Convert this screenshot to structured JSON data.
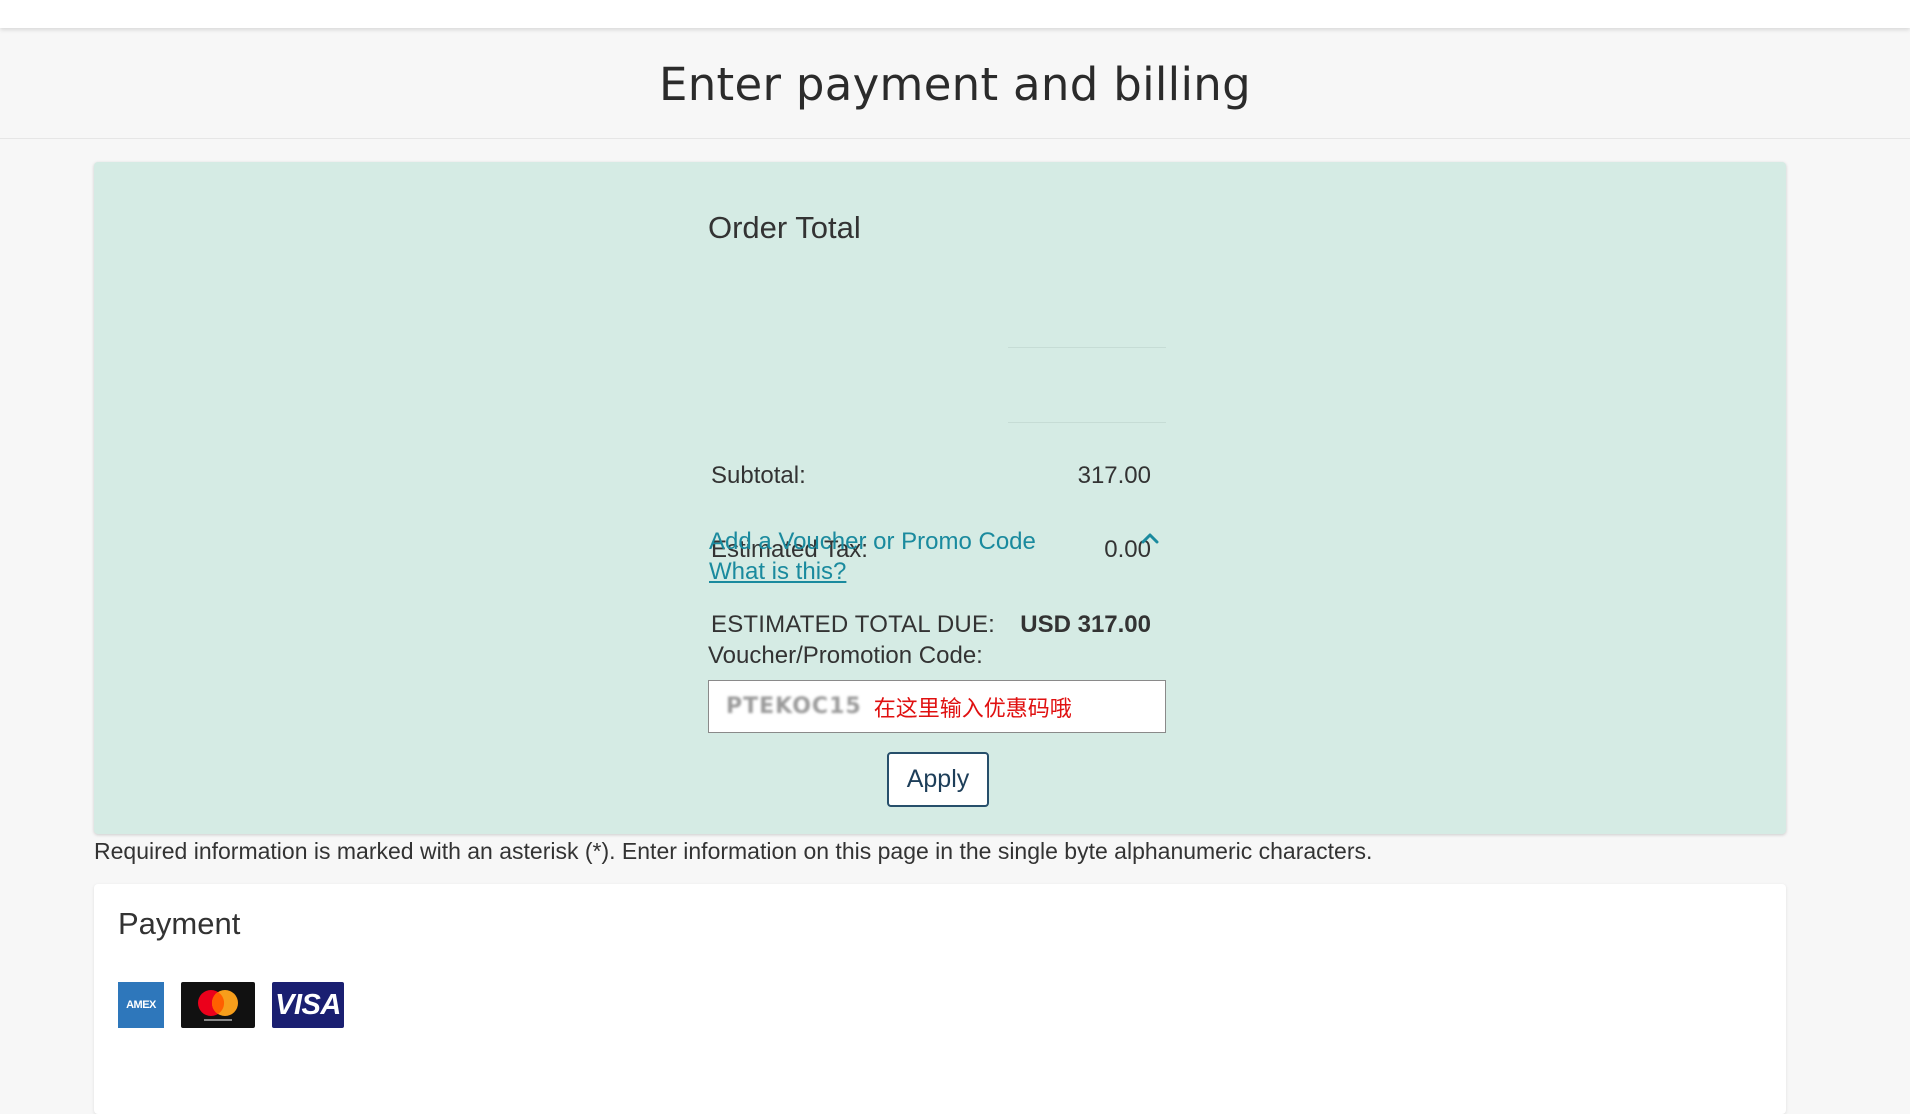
{
  "page": {
    "title": "Enter payment and billing"
  },
  "order": {
    "heading": "Order Total",
    "subtotal_label": "Subtotal:",
    "subtotal_value": "317.00",
    "tax_label": "Estimated Tax:",
    "tax_value": "0.00",
    "total_label": "ESTIMATED TOTAL DUE:",
    "total_value": "USD 317.00",
    "voucher_toggle": "Add a Voucher or Promo Code",
    "what_is_this": "What is this?",
    "voucher_label": "Voucher/Promotion Code:",
    "voucher_value": "PTEKOC15",
    "voucher_hint": "在这里输入优惠码哦",
    "apply_label": "Apply"
  },
  "notice": {
    "required_text": "Required information is marked with an asterisk (*). Enter information on this page in the single byte alphanumeric characters."
  },
  "payment": {
    "heading": "Payment",
    "cards": {
      "amex": "AMEX",
      "visa": "VISA"
    }
  },
  "colors": {
    "panel_background": "#d5ebe4",
    "link": "#1a8a9e",
    "hint": "#e01010",
    "button_border": "#274f6b"
  }
}
